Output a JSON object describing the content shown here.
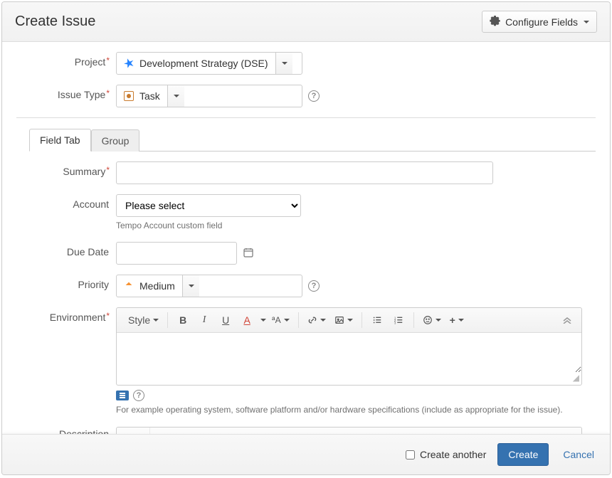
{
  "dialog": {
    "title": "Create Issue",
    "configure_btn": "Configure Fields"
  },
  "form": {
    "project": {
      "label": "Project",
      "value": "Development Strategy (DSE)"
    },
    "issue_type": {
      "label": "Issue Type",
      "value": "Task"
    },
    "tabs": {
      "field_tab": "Field Tab",
      "group": "Group"
    },
    "summary": {
      "label": "Summary",
      "value": ""
    },
    "account": {
      "label": "Account",
      "value": "Please select",
      "hint": "Tempo Account custom field"
    },
    "due_date": {
      "label": "Due Date",
      "value": ""
    },
    "priority": {
      "label": "Priority",
      "value": "Medium"
    },
    "environment": {
      "label": "Environment",
      "hint": "For example operating system, software platform and/or hardware specifications (include as appropriate for the issue)."
    },
    "description": {
      "label": "Description"
    },
    "rte": {
      "style": "Style"
    }
  },
  "footer": {
    "create_another": "Create another",
    "create": "Create",
    "cancel": "Cancel"
  }
}
